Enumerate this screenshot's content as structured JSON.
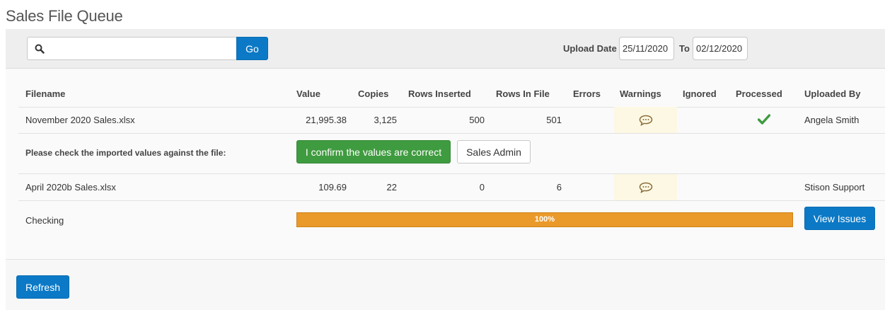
{
  "page": {
    "title": "Sales File Queue"
  },
  "search": {
    "placeholder": "",
    "value": "",
    "go_label": "Go"
  },
  "filters": {
    "upload_date_label": "Upload Date",
    "date_from": "25/11/2020",
    "to_label": "To",
    "date_to": "02/12/2020"
  },
  "table": {
    "headers": {
      "filename": "Filename",
      "value": "Value",
      "copies": "Copies",
      "rows_inserted": "Rows Inserted",
      "rows_in_file": "Rows In File",
      "errors": "Errors",
      "warnings": "Warnings",
      "ignored": "Ignored",
      "processed": "Processed",
      "uploaded_by": "Uploaded By"
    },
    "rows": [
      {
        "filename": "November 2020 Sales.xlsx",
        "value": "21,995.38",
        "copies": "3,125",
        "rows_inserted": "500",
        "rows_in_file": "501",
        "errors": "",
        "warnings_icon": "comment-icon",
        "ignored": "",
        "processed_icon": "check-icon",
        "uploaded_by": "Angela Smith",
        "confirm_prompt": "Please check the imported values against the file:",
        "confirm_label": "I confirm the values are correct",
        "secondary_label": "Sales Admin"
      },
      {
        "filename": "April 2020b Sales.xlsx",
        "value": "109.69",
        "copies": "22",
        "rows_inserted": "0",
        "rows_in_file": "6",
        "errors": "",
        "warnings_icon": "comment-icon",
        "ignored": "",
        "uploaded_by": "Stison Support",
        "status": "Checking",
        "progress_percent": 100,
        "progress_label": "100%",
        "action_label": "View Issues"
      }
    ]
  },
  "footer": {
    "refresh_label": "Refresh"
  },
  "colors": {
    "primary": "#0b79c6",
    "success": "#3f9b3f",
    "warning_bg": "#fcf8e3",
    "progress": "#ea9a2a",
    "check": "#3f9b3f"
  }
}
